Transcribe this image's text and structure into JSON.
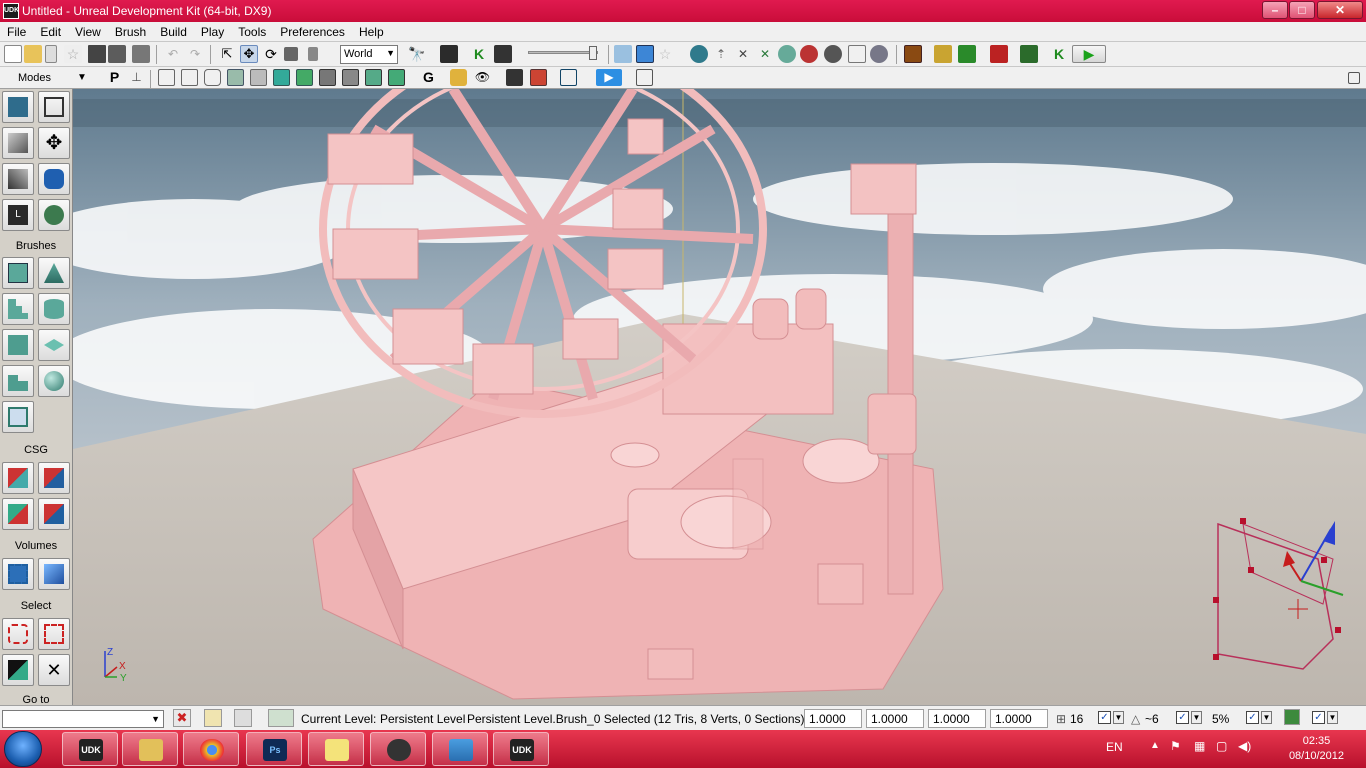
{
  "titlebar": {
    "app_badge": "UDK",
    "title": "Untitled - Unreal Development Kit (64-bit, DX9)",
    "minimize": "–",
    "maximize": "□",
    "close": "✕"
  },
  "menu": [
    "File",
    "Edit",
    "View",
    "Brush",
    "Build",
    "Play",
    "Tools",
    "Preferences",
    "Help"
  ],
  "toolbar": {
    "coordinate_system": "World",
    "letter_k": "K"
  },
  "toolbar2": {
    "letter_p": "P",
    "letter_g": "G"
  },
  "modes": {
    "label": "Modes"
  },
  "panels": {
    "brushes": "Brushes",
    "csg": "CSG",
    "volumes": "Volumes",
    "select": "Select",
    "goto": "Go to"
  },
  "viewport": {
    "axis_z": "Z",
    "axis_x": "X",
    "axis_y": "Y"
  },
  "status": {
    "current_level_label": "Current Level:",
    "current_level_value": "Persistent Level",
    "selection": "Persistent Level.Brush_0 Selected (12 Tris, 8 Verts, 0 Sections)",
    "drag_x": "1.0000",
    "drag_y": "1.0000",
    "drag_z": "1.0000",
    "drag_all": "1.0000",
    "grid_size": "16",
    "rotation_snap": "~6",
    "scale_snap": "5%"
  },
  "taskbar": {
    "apps": [
      "UDK",
      "Windows Explorer",
      "Google Chrome",
      "Photoshop",
      "Sticky Notes",
      "App",
      "Photo Viewer",
      "UDK"
    ],
    "language": "EN",
    "time": "02:35",
    "date": "08/10/2012"
  },
  "colors": {
    "titlebar": "#d4173f",
    "model": "#f2bcbc",
    "taskbar": "#cc1b36",
    "sky": "#7e95a8",
    "floor": "#cdc8c1"
  }
}
